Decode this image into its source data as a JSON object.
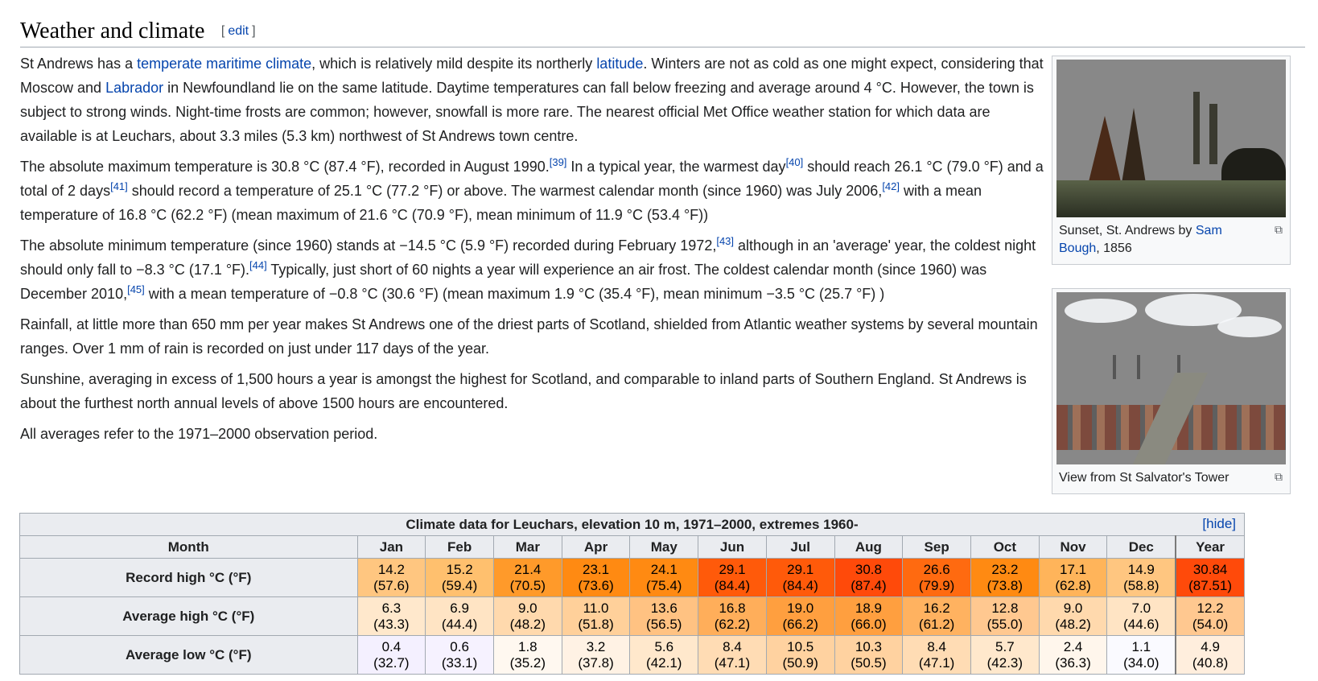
{
  "heading": {
    "title": "Weather and climate",
    "edit_open": "[",
    "edit_label": "edit",
    "edit_close": "]"
  },
  "paragraphs": [
    {
      "parts": [
        {
          "t": "St Andrews has a "
        },
        {
          "t": "temperate maritime climate",
          "link": true
        },
        {
          "t": ", which is relatively mild despite its northerly "
        },
        {
          "t": "latitude",
          "link": true
        },
        {
          "t": ". Winters are not as cold as one might expect, considering that Moscow and "
        },
        {
          "t": "Labrador",
          "link": true
        },
        {
          "t": " in Newfoundland lie on the same latitude. Daytime temperatures can fall below freezing and average around 4 °C. However, the town is subject to strong winds. Night-time frosts are common; however, snowfall is more rare. The nearest official Met Office weather station for which data are available is at Leuchars, about 3.3 miles (5.3 km) northwest of St Andrews town centre."
        }
      ]
    },
    {
      "parts": [
        {
          "t": "The absolute maximum temperature is 30.8 °C (87.4 °F), recorded in August 1990."
        },
        {
          "t": "[39]",
          "sup": true
        },
        {
          "t": " In a typical year, the warmest day"
        },
        {
          "t": "[40]",
          "sup": true
        },
        {
          "t": " should reach 26.1 °C (79.0 °F) and a total of 2 days"
        },
        {
          "t": "[41]",
          "sup": true
        },
        {
          "t": " should record a temperature of 25.1 °C (77.2 °F) or above. The warmest calendar month (since 1960) was July 2006,"
        },
        {
          "t": "[42]",
          "sup": true
        },
        {
          "t": " with a mean temperature of 16.8 °C (62.2 °F) (mean maximum of 21.6 °C (70.9 °F), mean minimum of 11.9 °C (53.4 °F))"
        }
      ]
    },
    {
      "parts": [
        {
          "t": "The absolute minimum temperature (since 1960) stands at −14.5 °C (5.9 °F) recorded during February 1972,"
        },
        {
          "t": "[43]",
          "sup": true
        },
        {
          "t": " although in an 'average' year, the coldest night should only fall to −8.3 °C (17.1 °F)."
        },
        {
          "t": "[44]",
          "sup": true
        },
        {
          "t": " Typically, just short of 60 nights a year will experience an air frost. The coldest calendar month (since 1960) was December 2010,"
        },
        {
          "t": "[45]",
          "sup": true
        },
        {
          "t": " with a mean temperature of −0.8 °C (30.6 °F) (mean maximum 1.9 °C (35.4 °F), mean minimum −3.5 °C (25.7 °F) )"
        }
      ]
    },
    {
      "parts": [
        {
          "t": "Rainfall, at little more than 650 mm per year makes St Andrews one of the driest parts of Scotland, shielded from Atlantic weather systems by several mountain ranges. Over 1 mm of rain is recorded on just under 117 days of the year."
        }
      ]
    },
    {
      "parts": [
        {
          "t": "Sunshine, averaging in excess of 1,500 hours a year is amongst the highest for Scotland, and comparable to inland parts of Southern England. St Andrews is about the furthest north annual levels of above 1500 hours are encountered."
        }
      ]
    },
    {
      "parts": [
        {
          "t": "All averages refer to the 1971–2000 observation period."
        }
      ]
    }
  ],
  "thumbs": [
    {
      "caption_before": "Sunset, St. Andrews by ",
      "caption_link": "Sam Bough",
      "caption_after": ", 1856",
      "icon": "magnify-icon",
      "magnify": "⧉"
    },
    {
      "caption_before": "View from St Salvator's Tower",
      "caption_link": "",
      "caption_after": "",
      "icon": "magnify-icon",
      "magnify": "⧉"
    }
  ],
  "climate": {
    "title": "Climate data for Leuchars, elevation 10 m, 1971–2000, extremes 1960-",
    "hide_label": "[hide]",
    "month_header": "Month",
    "months": [
      "Jan",
      "Feb",
      "Mar",
      "Apr",
      "May",
      "Jun",
      "Jul",
      "Aug",
      "Sep",
      "Oct",
      "Nov",
      "Dec",
      "Year"
    ],
    "rows": [
      {
        "label": "Record high °C (°F)",
        "c": [
          "14.2",
          "15.2",
          "21.4",
          "23.1",
          "24.1",
          "29.1",
          "29.1",
          "30.8",
          "26.6",
          "23.2",
          "17.1",
          "14.9",
          "30.84"
        ],
        "f": [
          "(57.6)",
          "(59.4)",
          "(70.5)",
          "(73.6)",
          "(75.4)",
          "(84.4)",
          "(84.4)",
          "(87.4)",
          "(79.9)",
          "(73.8)",
          "(62.8)",
          "(58.8)",
          "(87.51)"
        ],
        "colors": [
          "#ffc680",
          "#ffc06e",
          "#ff9a2a",
          "#ff8a12",
          "#ff8a12",
          "#ff5a0a",
          "#ff5a0a",
          "#ff4a0a",
          "#ff6a10",
          "#ff8a12",
          "#ffb45a",
          "#ffc680",
          "#ff4a0a"
        ]
      },
      {
        "label": "Average high °C (°F)",
        "c": [
          "6.3",
          "6.9",
          "9.0",
          "11.0",
          "13.6",
          "16.8",
          "19.0",
          "18.9",
          "16.2",
          "12.8",
          "9.0",
          "7.0",
          "12.2"
        ],
        "f": [
          "(43.3)",
          "(44.4)",
          "(48.2)",
          "(51.8)",
          "(56.5)",
          "(62.2)",
          "(66.2)",
          "(66.0)",
          "(61.2)",
          "(55.0)",
          "(48.2)",
          "(44.6)",
          "(54.0)"
        ],
        "colors": [
          "#ffe8cc",
          "#ffe4c4",
          "#ffd9ad",
          "#ffd09a",
          "#ffc282",
          "#ffae5a",
          "#ff9f3f",
          "#ff9f3f",
          "#ffb260",
          "#ffc890",
          "#ffd9ad",
          "#ffe4c4",
          "#ffc890"
        ]
      },
      {
        "label": "Average low °C (°F)",
        "c": [
          "0.4",
          "0.6",
          "1.8",
          "3.2",
          "5.6",
          "8.4",
          "10.5",
          "10.3",
          "8.4",
          "5.7",
          "2.4",
          "1.1",
          "4.9"
        ],
        "f": [
          "(32.7)",
          "(33.1)",
          "(35.2)",
          "(37.8)",
          "(42.1)",
          "(47.1)",
          "(50.9)",
          "(50.5)",
          "(47.1)",
          "(42.3)",
          "(36.3)",
          "(34.0)",
          "(40.8)"
        ],
        "colors": [
          "#f4f0ff",
          "#f6f2ff",
          "#fff8f0",
          "#fff2e4",
          "#ffe8cc",
          "#ffdcb4",
          "#ffd2a0",
          "#ffd2a0",
          "#ffdcb4",
          "#ffe8cc",
          "#fff6ec",
          "#fafaff",
          "#ffeedd"
        ]
      }
    ]
  }
}
